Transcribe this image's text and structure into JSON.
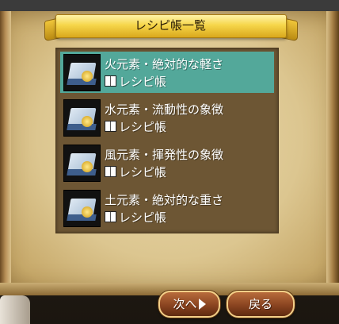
{
  "window": {
    "title": "レシピ帳一覧"
  },
  "recipes": [
    {
      "name": "火元素・絶対的な軽さ",
      "type": "レシピ帳",
      "selected": true,
      "icon": "recipe-book-icon"
    },
    {
      "name": "水元素・流動性の象徴",
      "type": "レシピ帳",
      "selected": false,
      "icon": "recipe-book-icon"
    },
    {
      "name": "風元素・揮発性の象徴",
      "type": "レシピ帳",
      "selected": false,
      "icon": "recipe-book-icon"
    },
    {
      "name": "土元素・絶対的な重さ",
      "type": "レシピ帳",
      "selected": false,
      "icon": "recipe-book-icon"
    }
  ],
  "buttons": {
    "next_label": "次へ",
    "back_label": "戻る"
  },
  "colors": {
    "selected_row": "#53a89a",
    "banner": "#f6d64a",
    "button": "#8a4420"
  }
}
